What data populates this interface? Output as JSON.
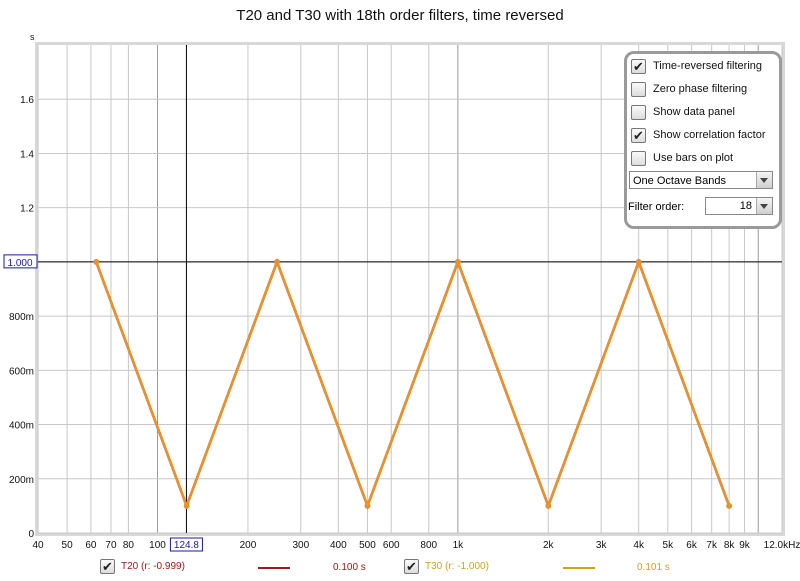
{
  "title": "T20 and T30 with 18th order filters, time reversed",
  "controls": {
    "options": [
      {
        "label": "Time-reversed filtering",
        "checked": true
      },
      {
        "label": "Zero phase filtering",
        "checked": false
      },
      {
        "label": "Show data panel",
        "checked": false
      },
      {
        "label": "Show correlation factor",
        "checked": true
      },
      {
        "label": "Use bars on plot",
        "checked": false
      }
    ],
    "band_select": "One Octave Bands",
    "filter_order_label": "Filter order:",
    "filter_order_value": "18"
  },
  "cursor": {
    "x_label": "124.8",
    "y_label": "1.000"
  },
  "legend": [
    {
      "label": "T20 (r: -0.999)",
      "value": "0.100 s",
      "color": "#a01818",
      "checked": true
    },
    {
      "label": "T30 (r: -1.000)",
      "value": "0.101 s",
      "color": "#d4a020",
      "checked": true
    }
  ],
  "chart_data": {
    "type": "line",
    "title": "T20 and T30 with 18th order filters, time reversed",
    "xlabel": "Hz",
    "ylabel": "s",
    "xscale": "log",
    "xlim": [
      40,
      12000
    ],
    "ylim": [
      0,
      1.8
    ],
    "grid": true,
    "x_ticks": [
      40,
      50,
      60,
      70,
      80,
      100,
      200,
      300,
      400,
      500,
      600,
      800,
      1000,
      2000,
      3000,
      4000,
      5000,
      6000,
      7000,
      8000,
      9000,
      12000
    ],
    "x_tick_labels": [
      "40",
      "50",
      "60",
      "70",
      "80",
      "100",
      "200",
      "300",
      "400",
      "500",
      "600",
      "800",
      "1k",
      "2k",
      "3k",
      "4k",
      "5k",
      "6k",
      "7k",
      "8k",
      "9k",
      "12.0kHz"
    ],
    "y_ticks": [
      0,
      0.2,
      0.4,
      0.6,
      0.8,
      1.0,
      1.2,
      1.4,
      1.6
    ],
    "y_tick_labels": [
      "0",
      "200m",
      "400m",
      "600m",
      "800m",
      "",
      "1.2",
      "1.4",
      "1.6"
    ],
    "x": [
      62.5,
      125,
      250,
      500,
      1000,
      2000,
      4000,
      8000
    ],
    "series": [
      {
        "name": "T20",
        "color": "#a01818",
        "values": [
          1.0,
          0.1,
          1.0,
          0.1,
          1.0,
          0.1,
          1.0,
          0.1
        ]
      },
      {
        "name": "T30",
        "color": "#e8922a",
        "values": [
          1.0,
          0.1,
          1.0,
          0.1,
          1.0,
          0.1,
          1.0,
          0.1
        ]
      }
    ],
    "legend_position": "bottom"
  }
}
